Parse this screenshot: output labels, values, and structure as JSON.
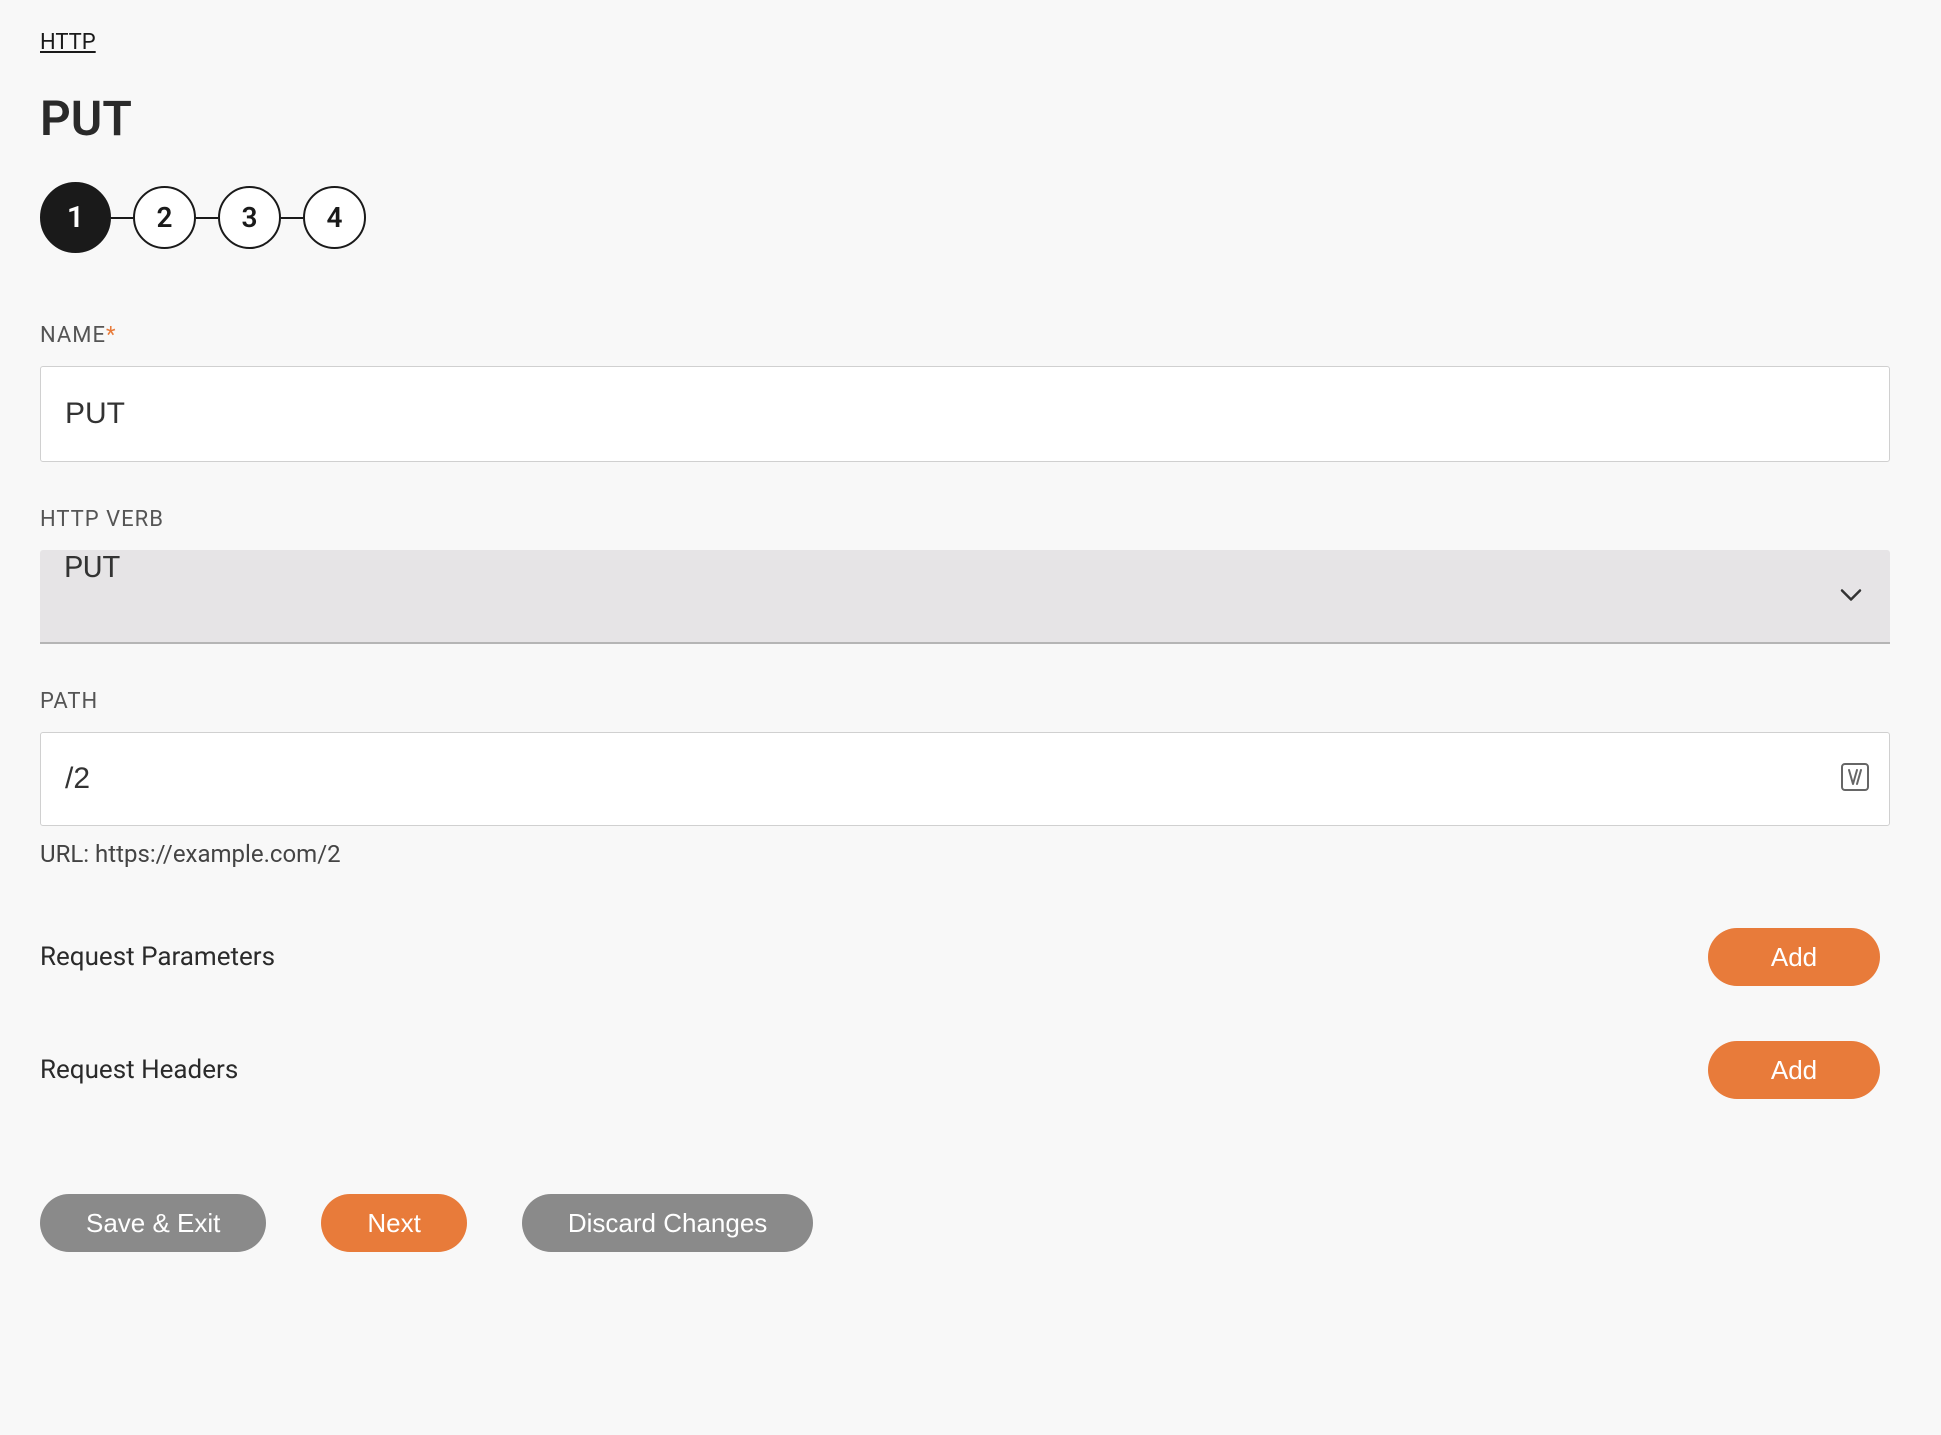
{
  "breadcrumb": {
    "label": "HTTP"
  },
  "page": {
    "title": "PUT"
  },
  "stepper": {
    "steps": [
      "1",
      "2",
      "3",
      "4"
    ],
    "activeIndex": 0
  },
  "form": {
    "name": {
      "label": "NAME",
      "required_mark": "*",
      "value": "PUT"
    },
    "http_verb": {
      "label": "HTTP VERB",
      "value": "PUT"
    },
    "path": {
      "label": "PATH",
      "value": "/2",
      "url_prefix": "URL: ",
      "url_value": "https://example.com/2"
    }
  },
  "sections": {
    "parameters": {
      "title": "Request Parameters",
      "add_label": "Add"
    },
    "headers": {
      "title": "Request Headers",
      "add_label": "Add"
    }
  },
  "actions": {
    "save_exit": "Save & Exit",
    "next": "Next",
    "discard": "Discard Changes"
  }
}
